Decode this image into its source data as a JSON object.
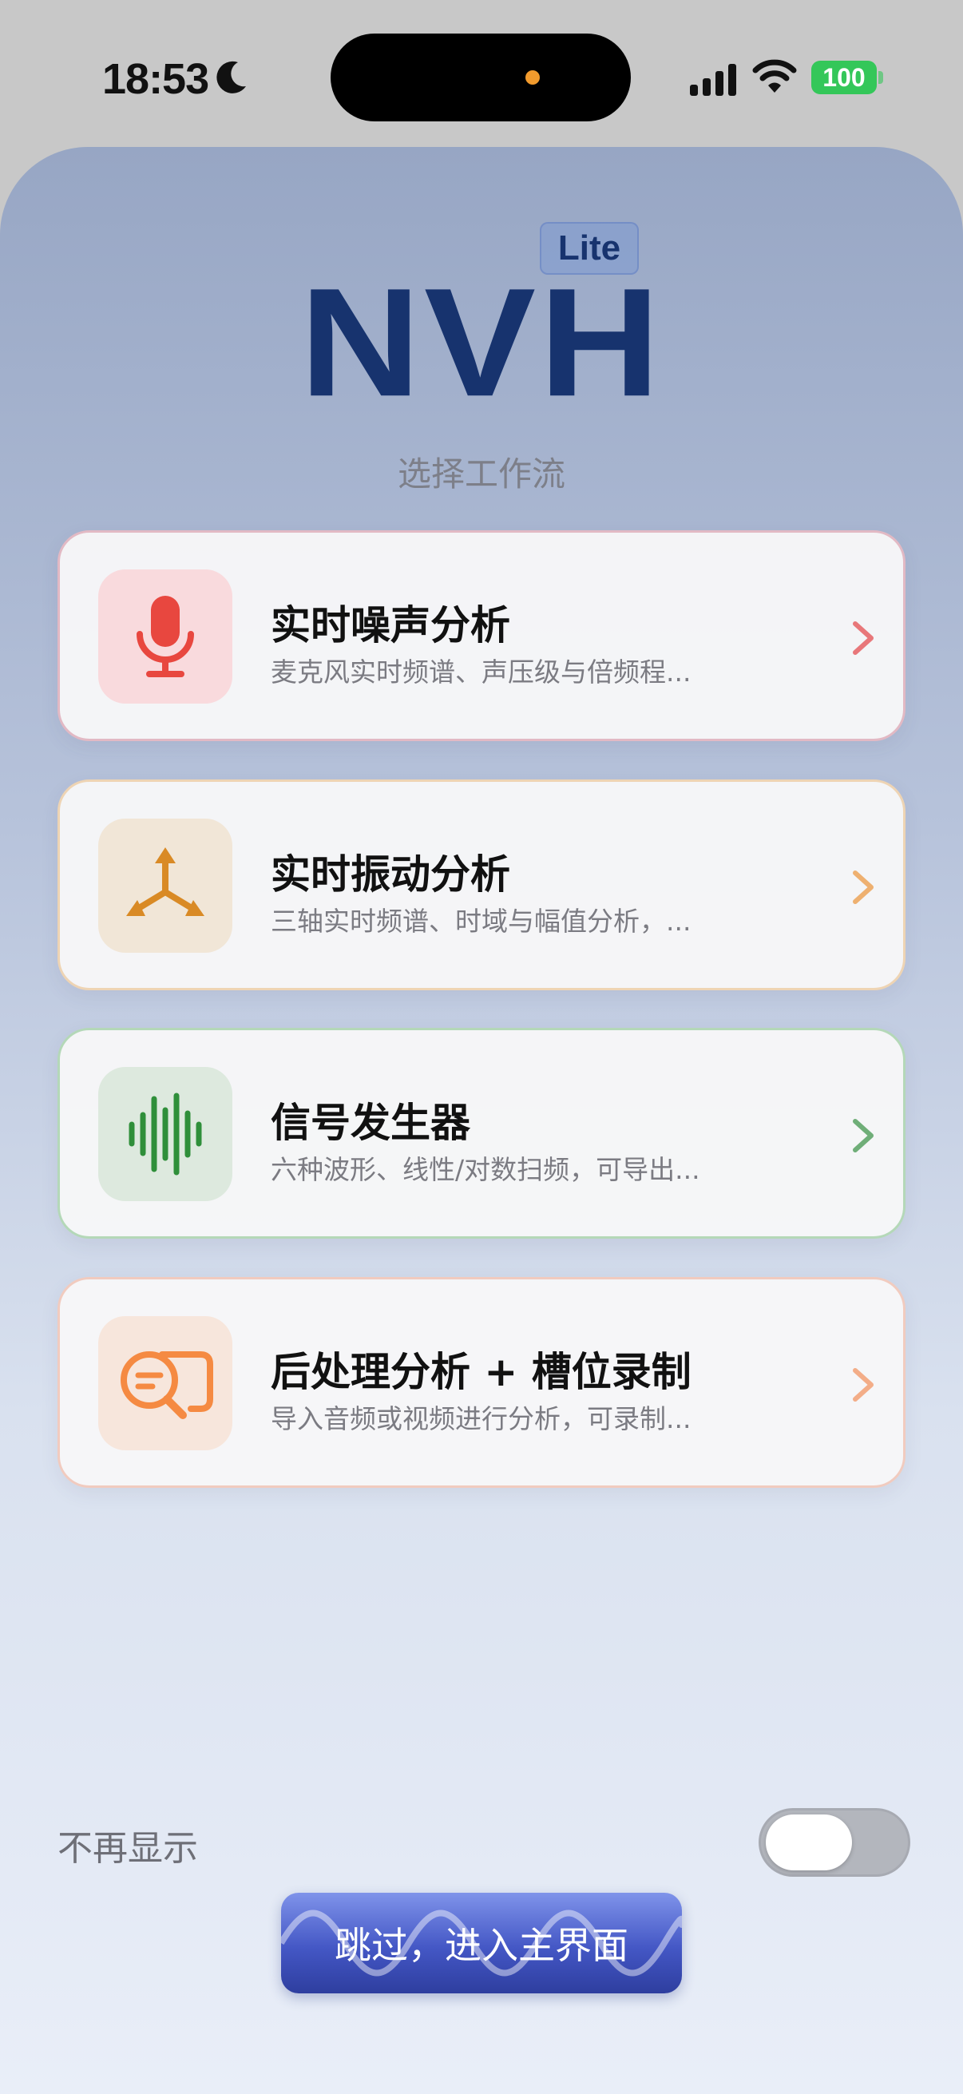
{
  "status_bar": {
    "time": "18:53",
    "battery": "100"
  },
  "app": {
    "logo": "NVH",
    "badge": "Lite",
    "subtitle": "选择工作流"
  },
  "workflows": [
    {
      "title": "实时噪声分析",
      "description": "麦克风实时频谱、声压级与倍频程...",
      "icon": "microphone-icon",
      "accent": "#e8473f",
      "bg": "#f9dadd"
    },
    {
      "title": "实时振动分析",
      "description": "三轴实时频谱、时域与幅值分析，...",
      "icon": "three-axis-icon",
      "accent": "#d98a25",
      "bg": "#f1e6d7"
    },
    {
      "title": "信号发生器",
      "description": "六种波形、线性/对数扫频，可导出...",
      "icon": "waveform-icon",
      "accent": "#2f8f3a",
      "bg": "#dde9de"
    },
    {
      "title": "后处理分析 + 槽位录制",
      "description": "导入音频或视频进行分析，可录制...",
      "icon": "chat-search-icon",
      "accent": "#f58a42",
      "bg": "#f7e6dc"
    }
  ],
  "footer": {
    "dont_show_label": "不再显示",
    "toggle_on": false,
    "skip_button": "跳过，进入主界面"
  }
}
